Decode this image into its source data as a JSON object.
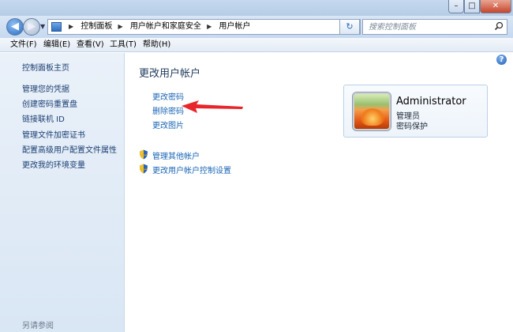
{
  "window": {
    "minimize_symbol": "–",
    "maximize_symbol": "□",
    "close_symbol": "✕"
  },
  "nav": {
    "back_symbol": "◀",
    "forward_symbol": "▶",
    "dropdown_symbol": "▼"
  },
  "address": {
    "breadcrumbs": [
      "控制面板",
      "用户帐户和家庭安全",
      "用户帐户"
    ],
    "separator": "▶",
    "refresh_symbol": "↻"
  },
  "search": {
    "placeholder": "搜索控制面板",
    "icon": "search-icon"
  },
  "menu": [
    "文件(F)",
    "编辑(E)",
    "查看(V)",
    "工具(T)",
    "帮助(H)"
  ],
  "left_pane": {
    "home": "控制面板主页",
    "links": [
      "管理您的凭据",
      "创建密码重置盘",
      "链接联机 ID",
      "管理文件加密证书",
      "配置高级用户配置文件属性",
      "更改我的环境变量"
    ],
    "see_also": "另请参阅"
  },
  "main": {
    "help_symbol": "?",
    "title": "更改用户帐户",
    "tasks": [
      "更改密码",
      "删除密码",
      "更改图片"
    ],
    "shield_tasks": [
      "管理其他帐户",
      "更改用户帐户控制设置"
    ]
  },
  "account": {
    "name": "Administrator",
    "type": "管理员",
    "status": "密码保护"
  },
  "colors": {
    "link": "#1a65b5",
    "title": "#1e395b",
    "annotation_arrow": "#e8252a"
  }
}
